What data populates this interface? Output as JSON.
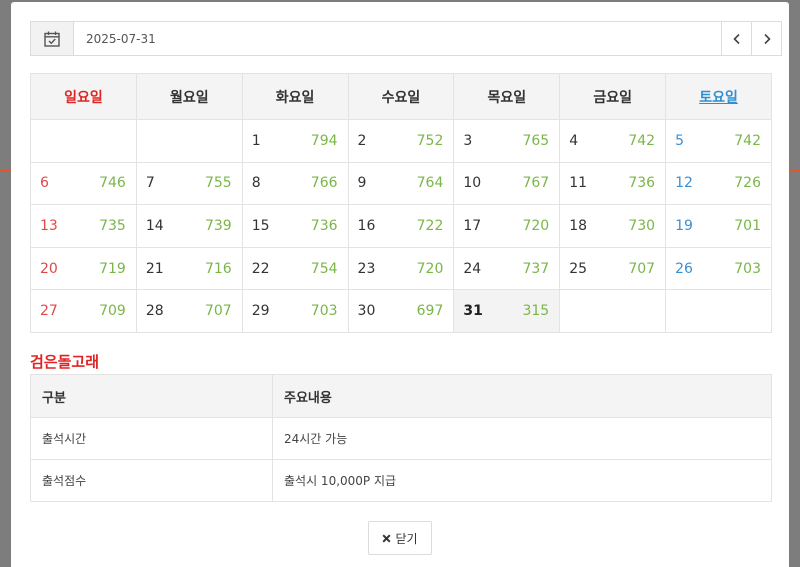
{
  "datebar": {
    "date_value": "2025-07-31",
    "prev_icon": "chevron-left-icon",
    "next_icon": "chevron-right-icon",
    "calendar_icon": "calendar-icon"
  },
  "calendar": {
    "weekdays": [
      "일요일",
      "월요일",
      "화요일",
      "수요일",
      "목요일",
      "금요일",
      "토요일"
    ],
    "weeks": [
      [
        {
          "d": "",
          "n": ""
        },
        {
          "d": "",
          "n": ""
        },
        {
          "d": "1",
          "n": "794"
        },
        {
          "d": "2",
          "n": "752"
        },
        {
          "d": "3",
          "n": "765"
        },
        {
          "d": "4",
          "n": "742"
        },
        {
          "d": "5",
          "n": "742"
        }
      ],
      [
        {
          "d": "6",
          "n": "746"
        },
        {
          "d": "7",
          "n": "755"
        },
        {
          "d": "8",
          "n": "766"
        },
        {
          "d": "9",
          "n": "764"
        },
        {
          "d": "10",
          "n": "767"
        },
        {
          "d": "11",
          "n": "736"
        },
        {
          "d": "12",
          "n": "726"
        }
      ],
      [
        {
          "d": "13",
          "n": "735"
        },
        {
          "d": "14",
          "n": "739"
        },
        {
          "d": "15",
          "n": "736"
        },
        {
          "d": "16",
          "n": "722"
        },
        {
          "d": "17",
          "n": "720"
        },
        {
          "d": "18",
          "n": "730"
        },
        {
          "d": "19",
          "n": "701"
        }
      ],
      [
        {
          "d": "20",
          "n": "719"
        },
        {
          "d": "21",
          "n": "716"
        },
        {
          "d": "22",
          "n": "754"
        },
        {
          "d": "23",
          "n": "720"
        },
        {
          "d": "24",
          "n": "737"
        },
        {
          "d": "25",
          "n": "707"
        },
        {
          "d": "26",
          "n": "703"
        }
      ],
      [
        {
          "d": "27",
          "n": "709"
        },
        {
          "d": "28",
          "n": "707"
        },
        {
          "d": "29",
          "n": "703"
        },
        {
          "d": "30",
          "n": "697"
        },
        {
          "d": "31",
          "n": "315"
        },
        {
          "d": "",
          "n": ""
        },
        {
          "d": "",
          "n": ""
        }
      ]
    ],
    "today": "31",
    "colors": {
      "sunday": "#e02424",
      "saturday": "#2f8fd3",
      "count": "#7ab648"
    }
  },
  "section": {
    "title": "검은돌고래"
  },
  "info": {
    "headers": [
      "구분",
      "주요내용"
    ],
    "rows": [
      [
        "출석시간",
        "24시간 가능"
      ],
      [
        "출석점수",
        "출석시 10,000P 지급"
      ]
    ]
  },
  "footer": {
    "close_label": "닫기",
    "close_icon": "close-icon"
  }
}
